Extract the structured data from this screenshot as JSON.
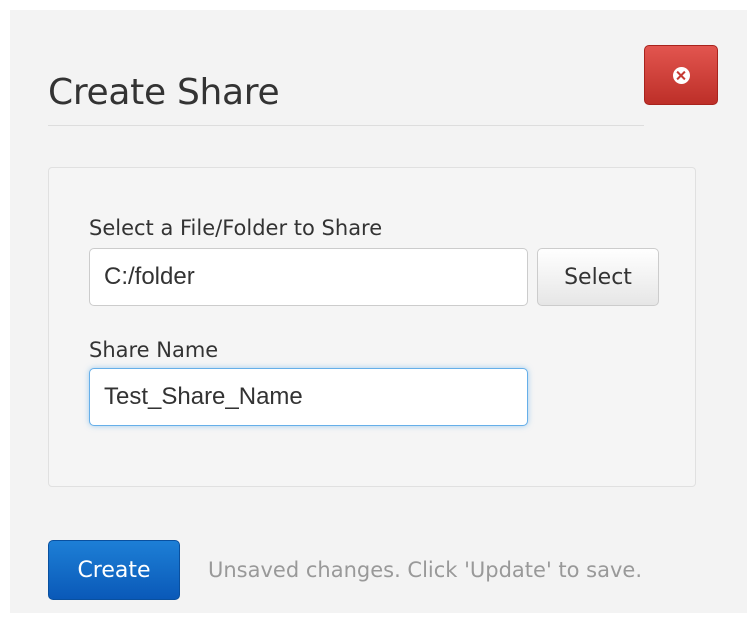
{
  "dialog": {
    "title": "Create Share",
    "close_icon": "close-circle-icon",
    "accent_danger": "#d9534f",
    "accent_primary": "#0e6dcd"
  },
  "form": {
    "path_label": "Select a File/Folder to Share",
    "path_value": "C:/folder",
    "select_label": "Select",
    "name_label": "Share Name",
    "name_value": "Test_Share_Name"
  },
  "footer": {
    "create_label": "Create",
    "status_text": "Unsaved changes. Click 'Update' to save."
  }
}
